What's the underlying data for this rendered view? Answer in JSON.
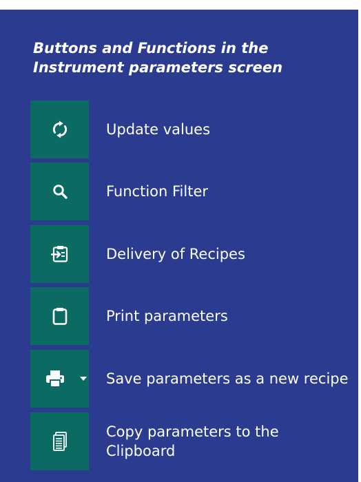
{
  "heading": {
    "title": "Buttons and Functions in the Instrument parameters screen"
  },
  "colors": {
    "panel_background": "#2b3b8f",
    "button_background": "#0b6b63",
    "text": "#ffffff"
  },
  "functions": [
    {
      "icon": "refresh-icon",
      "label": "Update values"
    },
    {
      "icon": "search-icon",
      "label": "Function Filter"
    },
    {
      "icon": "delivery-recipes-icon",
      "label": "Delivery of Recipes"
    },
    {
      "icon": "clipboard-icon",
      "label": "Print parameters"
    },
    {
      "icon": "printer-dropdown-icon",
      "label": "Save parameters as a new recipe"
    },
    {
      "icon": "copy-document-icon",
      "label": "Copy parameters to the Clipboard"
    }
  ]
}
